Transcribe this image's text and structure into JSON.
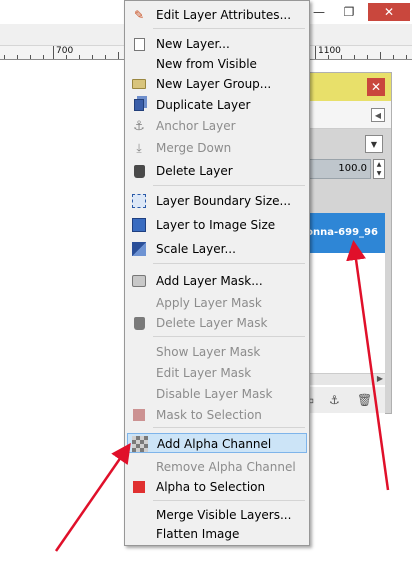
{
  "window": {
    "min_glyph": "—",
    "max_glyph": "❐",
    "close_glyph": "✕"
  },
  "ruler": {
    "labels": [
      "700",
      "1100"
    ]
  },
  "layers_dialog": {
    "opacity_value": "100.0",
    "layer_name": "donna-699_96"
  },
  "menu": {
    "edit_layer_attributes": "Edit Layer Attributes...",
    "new_layer": "New Layer...",
    "new_from_visible": "New from Visible",
    "new_layer_group": "New Layer Group...",
    "duplicate_layer": "Duplicate Layer",
    "anchor_layer": "Anchor Layer",
    "merge_down": "Merge Down",
    "delete_layer": "Delete Layer",
    "layer_boundary_size": "Layer Boundary Size...",
    "layer_to_image_size": "Layer to Image Size",
    "scale_layer": "Scale Layer...",
    "add_layer_mask": "Add Layer Mask...",
    "apply_layer_mask": "Apply Layer Mask",
    "delete_layer_mask": "Delete Layer Mask",
    "show_layer_mask": "Show Layer Mask",
    "edit_layer_mask": "Edit Layer Mask",
    "disable_layer_mask": "Disable Layer Mask",
    "mask_to_selection": "Mask to Selection",
    "add_alpha_channel": "Add Alpha Channel",
    "remove_alpha_channel": "Remove Alpha Channel",
    "alpha_to_selection": "Alpha to Selection",
    "merge_visible_layers": "Merge Visible Layers...",
    "flatten_image": "Flatten Image"
  },
  "colors": {
    "highlight": "#cce4f7",
    "arrow": "#e0102a",
    "selected_layer": "#2e86d6",
    "dialog_header": "#e8e06a"
  }
}
